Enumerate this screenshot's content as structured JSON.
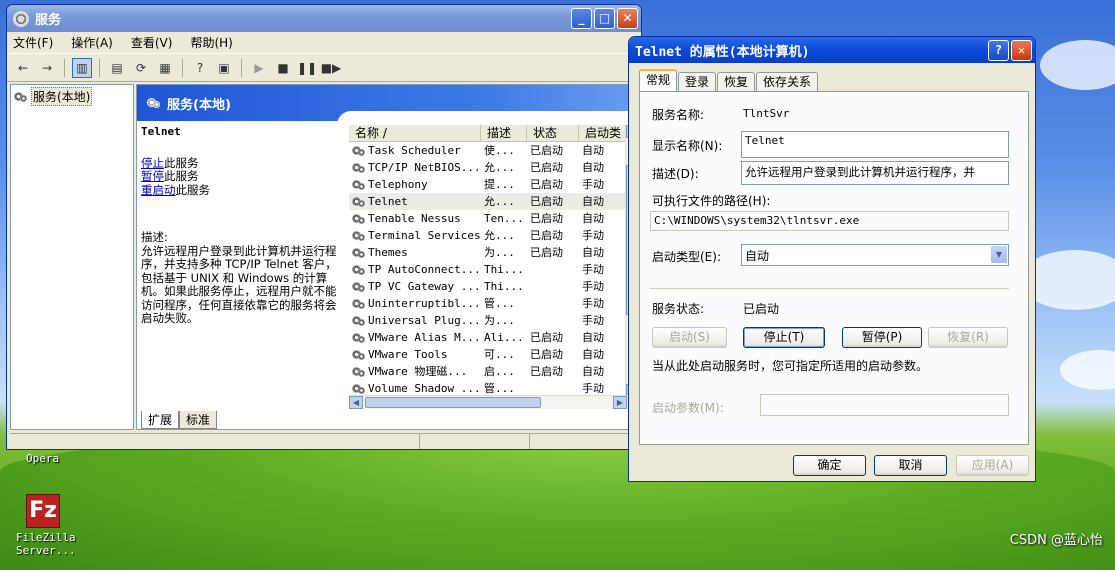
{
  "desktop": {
    "opera_label": "Opera",
    "filezilla_label_1": "FileZilla",
    "filezilla_label_2": "Server...",
    "watermark": "CSDN @蓝心怡"
  },
  "services_window": {
    "title": "服务",
    "menu": [
      "文件(F)",
      "操作(A)",
      "查看(V)",
      "帮助(H)"
    ],
    "tree_item": "服务(本地)",
    "header": "服务(本地)",
    "detail": {
      "service_name": "Telnet",
      "stop_link": "停止",
      "stop_suffix": "此服务",
      "pause_link": "暂停",
      "pause_suffix": "此服务",
      "restart_link": "重启动",
      "restart_suffix": "此服务",
      "desc_label": "描述:",
      "desc_text": "允许远程用户登录到此计算机并运行程序，并支持多种 TCP/IP Telnet 客户，包括基于 UNIX 和 Windows 的计算机。如果此服务停止，远程用户就不能访问程序，任何直接依靠它的服务将会启动失败。"
    },
    "columns": [
      "名称 /",
      "描述",
      "状态",
      "启动类"
    ],
    "rows": [
      {
        "name": "Task Scheduler",
        "desc": "使...",
        "status": "已启动",
        "startup": "自动"
      },
      {
        "name": "TCP/IP NetBIOS...",
        "desc": "允...",
        "status": "已启动",
        "startup": "自动"
      },
      {
        "name": "Telephony",
        "desc": "提...",
        "status": "已启动",
        "startup": "手动"
      },
      {
        "name": "Telnet",
        "desc": "允...",
        "status": "已启动",
        "startup": "自动"
      },
      {
        "name": "Tenable Nessus",
        "desc": "Ten...",
        "status": "已启动",
        "startup": "自动"
      },
      {
        "name": "Terminal Services",
        "desc": "允...",
        "status": "已启动",
        "startup": "手动"
      },
      {
        "name": "Themes",
        "desc": "为...",
        "status": "已启动",
        "startup": "自动"
      },
      {
        "name": "TP AutoConnect...",
        "desc": "Thi...",
        "status": "",
        "startup": "手动"
      },
      {
        "name": "TP VC Gateway ...",
        "desc": "Thi...",
        "status": "",
        "startup": "手动"
      },
      {
        "name": "Uninterruptibl...",
        "desc": "管...",
        "status": "",
        "startup": "手动"
      },
      {
        "name": "Universal Plug...",
        "desc": "为...",
        "status": "",
        "startup": "手动"
      },
      {
        "name": "VMware Alias M...",
        "desc": "Ali...",
        "status": "已启动",
        "startup": "自动"
      },
      {
        "name": "VMware Tools",
        "desc": "可...",
        "status": "已启动",
        "startup": "自动"
      },
      {
        "name": "VMware 物理磁...",
        "desc": "启...",
        "status": "已启动",
        "startup": "自动"
      },
      {
        "name": "Volume Shadow ...",
        "desc": "管...",
        "status": "",
        "startup": "手动"
      }
    ],
    "tabs": [
      "扩展",
      "标准"
    ]
  },
  "dialog": {
    "title": "Telnet 的属性(本地计算机)",
    "tabs": [
      "常规",
      "登录",
      "恢复",
      "依存关系"
    ],
    "service_name_label": "服务名称:",
    "service_name_value": "TlntSvr",
    "display_name_label": "显示名称(N):",
    "display_name_value": "Telnet",
    "desc_label": "描述(D):",
    "desc_value": "允许远程用户登录到此计算机并运行程序，并",
    "path_label": "可执行文件的路径(H):",
    "path_value": "C:\\WINDOWS\\system32\\tlntsvr.exe",
    "startup_type_label": "启动类型(E):",
    "startup_type_value": "自动",
    "status_label": "服务状态:",
    "status_value": "已启动",
    "btn_start": "启动(S)",
    "btn_stop": "停止(T)",
    "btn_pause": "暂停(P)",
    "btn_resume": "恢复(R)",
    "hint": "当从此处启动服务时，您可指定所适用的启动参数。",
    "params_label": "启动参数(M):",
    "params_value": "",
    "ok": "确定",
    "cancel": "取消",
    "apply": "应用(A)"
  }
}
